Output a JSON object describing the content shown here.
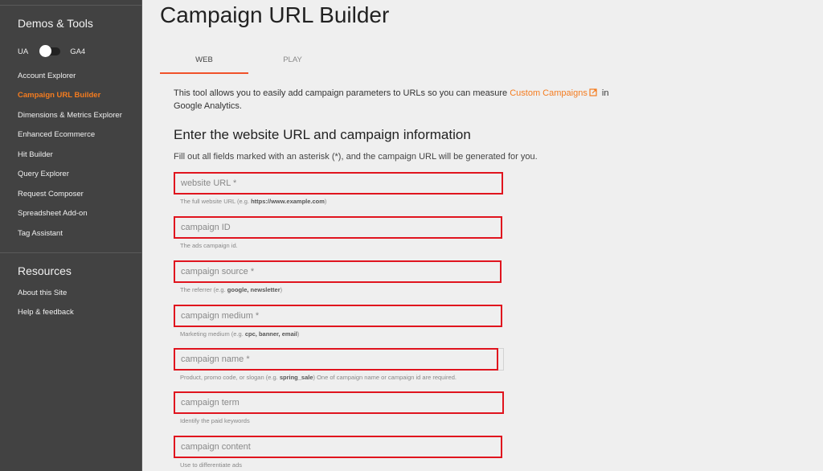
{
  "sidebar": {
    "section_demos": "Demos & Tools",
    "toggle": {
      "left_label": "UA",
      "right_label": "GA4",
      "state": "UA"
    },
    "items": [
      {
        "label": "Account Explorer",
        "active": false
      },
      {
        "label": "Campaign URL Builder",
        "active": true
      },
      {
        "label": "Dimensions & Metrics Explorer",
        "active": false
      },
      {
        "label": "Enhanced Ecommerce",
        "active": false
      },
      {
        "label": "Hit Builder",
        "active": false
      },
      {
        "label": "Query Explorer",
        "active": false
      },
      {
        "label": "Request Composer",
        "active": false
      },
      {
        "label": "Spreadsheet Add-on",
        "active": false
      },
      {
        "label": "Tag Assistant",
        "active": false
      }
    ],
    "section_resources": "Resources",
    "resources": [
      {
        "label": "About this Site"
      },
      {
        "label": "Help & feedback"
      }
    ]
  },
  "main": {
    "title": "Campaign URL Builder",
    "tabs": [
      {
        "label": "WEB",
        "active": true
      },
      {
        "label": "PLAY",
        "active": false
      }
    ],
    "intro": {
      "before": "This tool allows you to easily add campaign parameters to URLs so you can measure ",
      "link": "Custom Campaigns",
      "after": " in Google Analytics."
    },
    "section_title": "Enter the website URL and campaign information",
    "fill_note": "Fill out all fields marked with an asterisk (*), and the campaign URL will be generated for you.",
    "fields": [
      {
        "placeholder": "website URL *",
        "value": "",
        "hint_pre": "The full website URL (e.g. ",
        "hint_bold": "https://www.example.com",
        "hint_post": ")"
      },
      {
        "placeholder": "campaign ID",
        "value": "",
        "hint_pre": "The ads campaign id.",
        "hint_bold": "",
        "hint_post": ""
      },
      {
        "placeholder": "campaign source *",
        "value": "",
        "hint_pre": "The referrer (e.g. ",
        "hint_bold": "google, newsletter",
        "hint_post": ")"
      },
      {
        "placeholder": "campaign medium *",
        "value": "",
        "hint_pre": "Marketing medium (e.g. ",
        "hint_bold": "cpc, banner, email",
        "hint_post": ")"
      },
      {
        "placeholder": "campaign name *",
        "value": "",
        "hint_pre": "Product, promo code, or slogan (e.g. ",
        "hint_bold": "spring_sale",
        "hint_post": ") One of campaign name or campaign id are required."
      },
      {
        "placeholder": "campaign term",
        "value": "",
        "hint_pre": "Identify the paid keywords",
        "hint_bold": "",
        "hint_post": ""
      },
      {
        "placeholder": "campaign content",
        "value": "",
        "hint_pre": "Use to differentiate ads",
        "hint_bold": "",
        "hint_post": ""
      }
    ]
  },
  "colors": {
    "accent": "#f57c1f",
    "tab_underline": "#f0522a",
    "field_highlight": "#e0141e",
    "sidebar_bg": "#424242",
    "page_bg": "#efefef"
  }
}
